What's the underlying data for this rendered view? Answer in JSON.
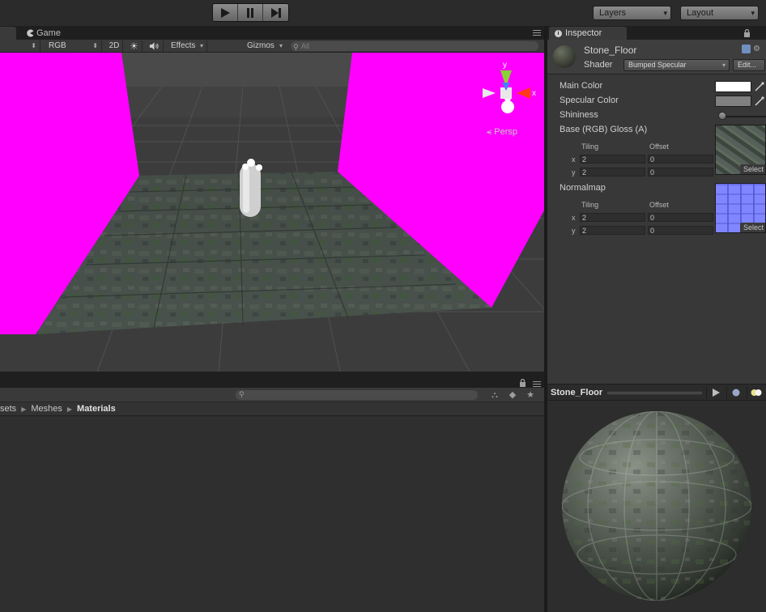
{
  "toolbar": {
    "play_icon": "play-icon",
    "pause_icon": "pause-icon",
    "step_icon": "step-icon",
    "layers_label": "Layers",
    "layout_label": "Layout"
  },
  "scene": {
    "tab_game": "Game",
    "view_mode": "RGB",
    "btn_2d": "2D",
    "effects_label": "Effects",
    "gizmos_label": "Gizmos",
    "search_placeholder": "All",
    "persp_label": "Persp",
    "axis_x": "x",
    "axis_y": "y",
    "colors": {
      "magenta_wall": "#ff00ff",
      "background": "#414141"
    }
  },
  "project": {
    "breadcrumb": [
      "sets",
      "Meshes",
      "Materials"
    ]
  },
  "inspector": {
    "tab_label": "Inspector",
    "material_name": "Stone_Floor",
    "shader_label": "Shader",
    "shader_value": "Bumped Specular",
    "edit_label": "Edit...",
    "main_color_label": "Main Color",
    "main_color": "#ffffff",
    "specular_color_label": "Specular Color",
    "specular_color": "#808080",
    "shininess_label": "Shininess",
    "shininess_value": 0.08,
    "base_label": "Base (RGB) Gloss (A)",
    "normal_label": "Normalmap",
    "tiling_label": "Tiling",
    "offset_label": "Offset",
    "x_label": "x",
    "y_label": "y",
    "select_label": "Select",
    "base_tiling": {
      "x": "2",
      "y": "2"
    },
    "base_offset": {
      "x": "0",
      "y": "0"
    },
    "normal_tiling": {
      "x": "2",
      "y": "2"
    },
    "normal_offset": {
      "x": "0",
      "y": "0"
    }
  },
  "preview": {
    "title": "Stone_Floor"
  }
}
